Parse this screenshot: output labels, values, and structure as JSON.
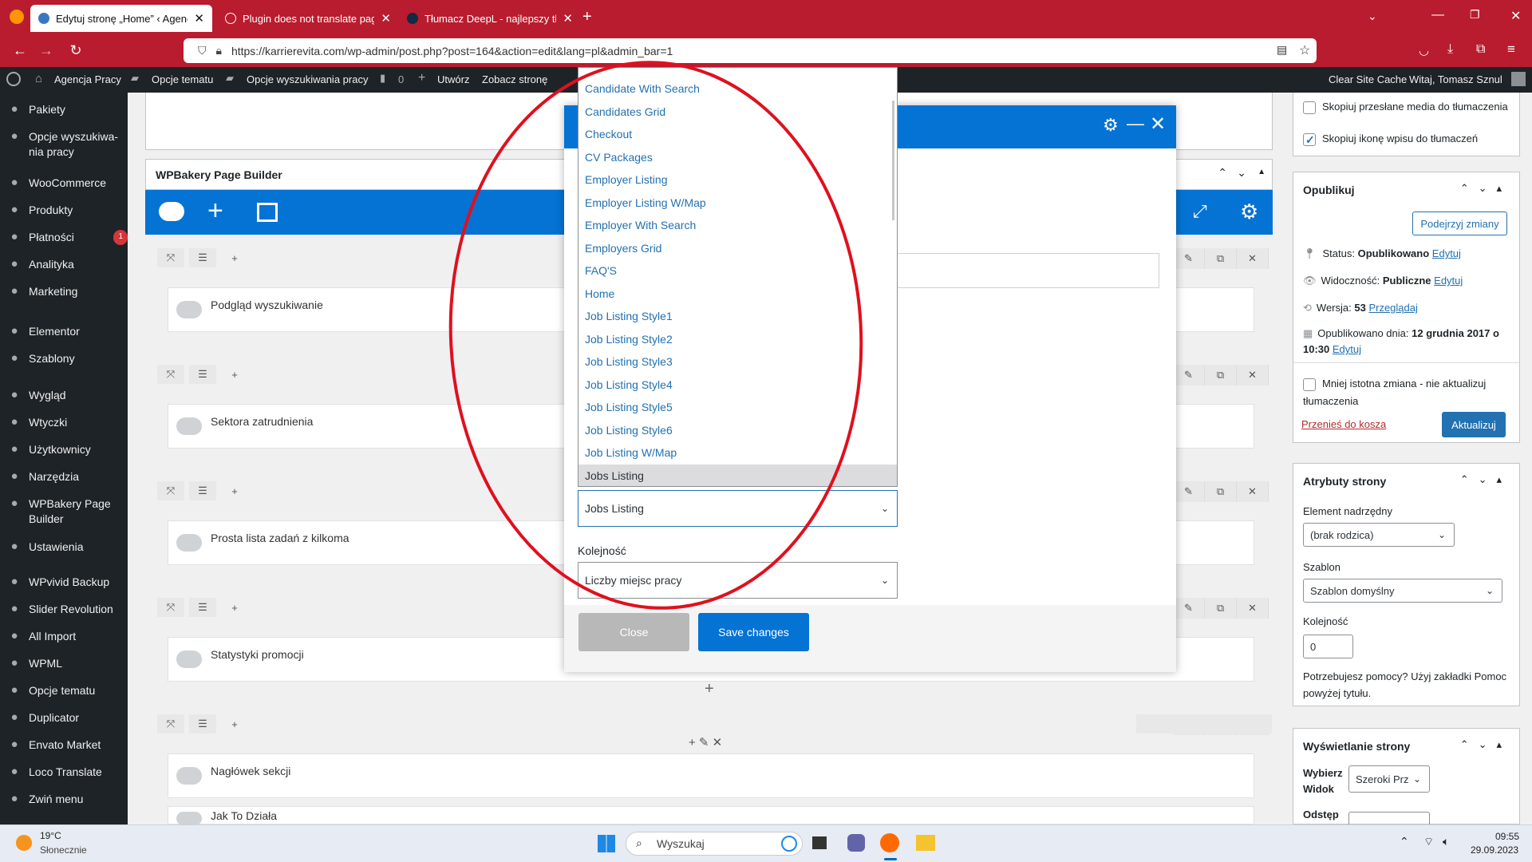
{
  "browser": {
    "tabs": [
      {
        "label": "Edytuj stronę „Home” ‹ Agencja",
        "active": true
      },
      {
        "label": "Plugin does not translate pages",
        "active": false
      },
      {
        "label": "Tłumacz DeepL - najlepszy tłum",
        "active": false
      }
    ],
    "url": "https://karrierevita.com/wp-admin/post.php?post=164&action=edit&lang=pl&admin_bar=1"
  },
  "adminbar": {
    "site": "Agencja Pracy",
    "theme_options": "Opcje tematu",
    "search_options": "Opcje wyszukiwania pracy",
    "comments": "0",
    "new": "Utwórz",
    "view": "Zobacz stronę",
    "clear_cache": "Clear Site Cache",
    "greeting": "Witaj, Tomasz Sznul"
  },
  "sidebar": {
    "items": [
      {
        "label": "Pakiety",
        "icon": "pin-icon"
      },
      {
        "label": "Opcje wyszukiwa-nia pracy",
        "icon": "gear-icon"
      },
      {
        "label": "WooCommerce",
        "icon": "woo-icon"
      },
      {
        "label": "Produkty",
        "icon": "box-icon"
      },
      {
        "label": "Płatności",
        "icon": "dollar-icon",
        "badge": "1"
      },
      {
        "label": "Analityka",
        "icon": "chart-icon"
      },
      {
        "label": "Marketing",
        "icon": "megaphone-icon"
      },
      {
        "label": "Elementor",
        "icon": "elementor-icon"
      },
      {
        "label": "Szablony",
        "icon": "folder-icon"
      },
      {
        "label": "Wygląd",
        "icon": "brush-icon"
      },
      {
        "label": "Wtyczki",
        "icon": "plug-icon"
      },
      {
        "label": "Użytkownicy",
        "icon": "user-icon"
      },
      {
        "label": "Narzędzia",
        "icon": "wrench-icon"
      },
      {
        "label": "WPBakery Page Builder",
        "icon": "cloud-icon"
      },
      {
        "label": "Ustawienia",
        "icon": "settings-icon"
      },
      {
        "label": "WPvivid Backup",
        "icon": "cloud-icon"
      },
      {
        "label": "Slider Revolution",
        "icon": "refresh-icon"
      },
      {
        "label": "All Import",
        "icon": "import-icon"
      },
      {
        "label": "WPML",
        "icon": "globe-icon"
      },
      {
        "label": "Opcje tematu",
        "icon": "gear-icon"
      },
      {
        "label": "Duplicator",
        "icon": "duplicate-icon"
      },
      {
        "label": "Envato Market",
        "icon": "leaf-icon"
      },
      {
        "label": "Loco Translate",
        "icon": "translate-icon"
      },
      {
        "label": "Zwiń menu",
        "icon": "collapse-icon"
      }
    ]
  },
  "builder": {
    "title": "WPBakery Page Builder",
    "rows": [
      "Podgląd wyszukiwanie",
      "Sektora zatrudnienia",
      "Prosta lista zadań z kilkoma",
      "Statystyki promocji",
      "Nagłówek sekcji",
      "Jak To Działa"
    ]
  },
  "dropdown": {
    "options": [
      "Candidate With Search",
      "Candidates Grid",
      "Checkout",
      "CV Packages",
      "Employer Listing",
      "Employer Listing W/Map",
      "Employer With Search",
      "Employers Grid",
      "FAQ'S",
      "Home",
      "Job Listing Style1",
      "Job Listing Style2",
      "Job Listing Style3",
      "Job Listing Style4",
      "Job Listing Style5",
      "Job Listing Style6",
      "Job Listing W/Map",
      "Jobs Listing"
    ],
    "highlighted": "Jobs Listing"
  },
  "modal": {
    "page_select_value": "Jobs Listing",
    "order_label": "Kolejność",
    "order_value": "Liczby miejsc pracy",
    "close_label": "Close",
    "save_label": "Save changes"
  },
  "right": {
    "copy_media": "Skopiuj przesłane media do tłumaczenia",
    "copy_icon": "Skopiuj ikonę wpisu do tłumaczeń",
    "publish": {
      "title": "Opublikuj",
      "preview": "Podejrzyj zmiany",
      "status_label": "Status:",
      "status_value": "Opublikowano",
      "visibility_label": "Widoczność:",
      "visibility_value": "Publiczne",
      "version_label": "Wersja:",
      "version_value": "53",
      "version_link": "Przeglądaj",
      "published_label": "Opublikowano dnia:",
      "published_value": "12 grudnia 2017 o",
      "published_time": "10:30",
      "edit": "Edytuj",
      "minor_change": "Mniej istotna zmiana - nie aktualizuj tłumaczenia",
      "trash": "Przenieś do kosza",
      "update": "Aktualizuj"
    },
    "attributes": {
      "title": "Atrybuty strony",
      "parent_label": "Element nadrzędny",
      "parent_value": "(brak rodzica)",
      "template_label": "Szablon",
      "template_value": "Szablon domyślny",
      "order_label": "Kolejność",
      "order_value": "0",
      "help": "Potrzebujesz pomocy? Użyj zakładki Pomoc powyżej tytułu."
    },
    "display": {
      "title": "Wyświetlanie strony",
      "choose_width_label": "Wybierz Widok",
      "choose_width_value": "Szeroki Prz",
      "spacing_label": "Odstęp"
    }
  },
  "taskbar": {
    "weather_temp": "19°C",
    "weather_desc": "Słonecznie",
    "search_placeholder": "Wyszukaj",
    "time": "09:55",
    "date": "29.09.2023"
  },
  "colors": {
    "browser": "#b91c2e",
    "wpbakery_blue": "#0473d4",
    "annotation": "#e0101e"
  }
}
